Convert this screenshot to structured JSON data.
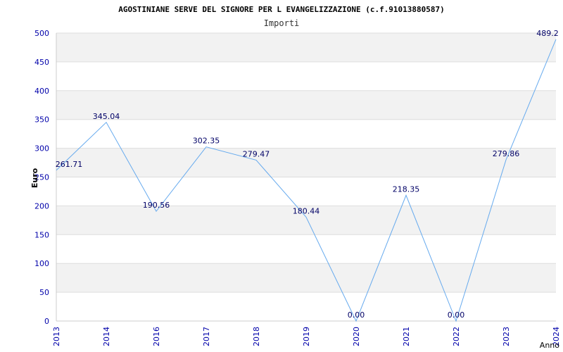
{
  "chart_data": {
    "type": "line",
    "title": "AGOSTINIANE SERVE DEL SIGNORE PER L EVANGELIZZAZIONE (c.f.91013880587)",
    "subtitle": "Importi",
    "xlabel": "Anno",
    "ylabel": "Euro",
    "categories": [
      "2013",
      "2014",
      "2016",
      "2017",
      "2018",
      "2019",
      "2020",
      "2021",
      "2022",
      "2023",
      "2024"
    ],
    "values": [
      261.71,
      345.04,
      190.56,
      302.35,
      279.47,
      180.44,
      0.0,
      218.35,
      0.0,
      279.86,
      489.2
    ],
    "value_labels": [
      "261.71",
      "345.04",
      "190.56",
      "302.35",
      "279.47",
      "180.44",
      "0.00",
      "218.35",
      "0.00",
      "279.86",
      "489.2"
    ],
    "ylim": [
      0,
      500
    ],
    "yticks": [
      0,
      50,
      100,
      150,
      200,
      250,
      300,
      350,
      400,
      450,
      500
    ],
    "grid": true,
    "colors": {
      "line": "#66aaee",
      "band": "#f2f2f2",
      "gridline": "#dddddd",
      "axis_text": "#0000aa",
      "data_label": "#000066",
      "title": "#000000"
    }
  }
}
